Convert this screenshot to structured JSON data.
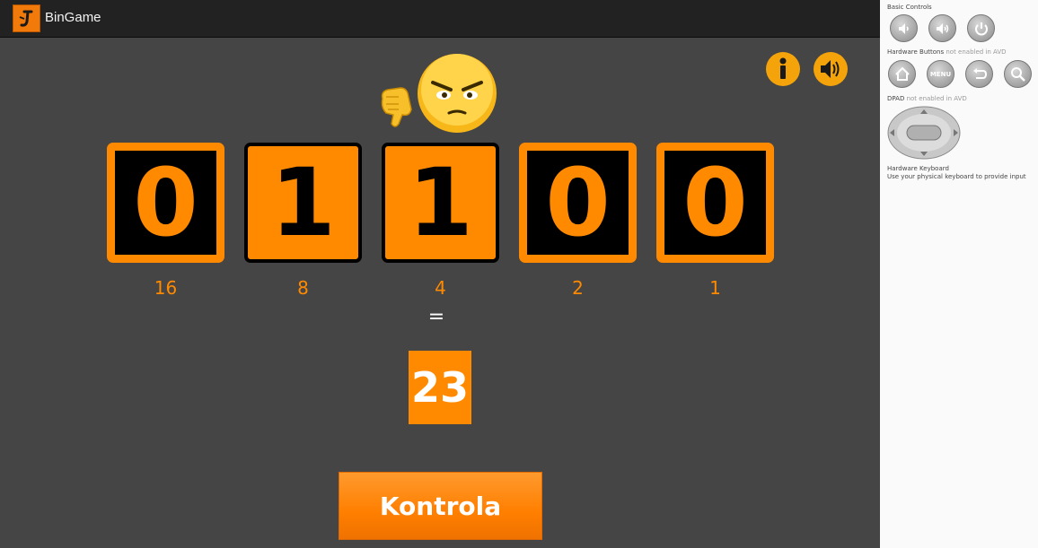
{
  "app": {
    "title": "BinGame"
  },
  "toolbar": {
    "info_icon": "info-icon",
    "sound_icon": "speaker-icon"
  },
  "feedback": {
    "face_icon": "angry-face-icon",
    "thumb_icon": "thumbs-down-icon"
  },
  "bits": [
    {
      "value": "0",
      "weight": "16",
      "state": "off"
    },
    {
      "value": "1",
      "weight": "8",
      "state": "on"
    },
    {
      "value": "1",
      "weight": "4",
      "state": "on"
    },
    {
      "value": "0",
      "weight": "2",
      "state": "off"
    },
    {
      "value": "0",
      "weight": "1",
      "state": "off"
    }
  ],
  "equals": "=",
  "target": "23",
  "check_button": "Kontrola",
  "colors": {
    "accent": "#ff8a00",
    "background": "#454545",
    "titlebar": "#222222"
  },
  "emulator": {
    "basic_controls": "Basic Controls",
    "hardware_buttons": "Hardware Buttons",
    "hardware_buttons_note": "not enabled in AVD",
    "dpad": "DPAD",
    "dpad_note": "not enabled in AVD",
    "keyboard": "Hardware Keyboard",
    "keyboard_note": "Use your physical keyboard to provide input",
    "menu_label": "MENU"
  }
}
